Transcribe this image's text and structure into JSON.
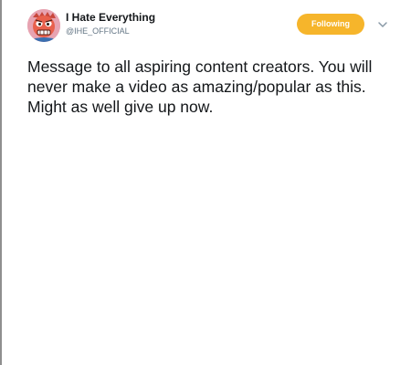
{
  "tweet": {
    "author": {
      "display_name": "I Hate Everything",
      "handle": "@IHE_OFFICIAL",
      "avatar_icon": "cartoon-character-avatar"
    },
    "follow_button": {
      "label": "Following",
      "color": "#f6b52b"
    },
    "menu_icon": "chevron-down-icon",
    "text": "Message to all aspiring content creators. You will never make a video as amazing/popular as this. Might as well give up now."
  }
}
